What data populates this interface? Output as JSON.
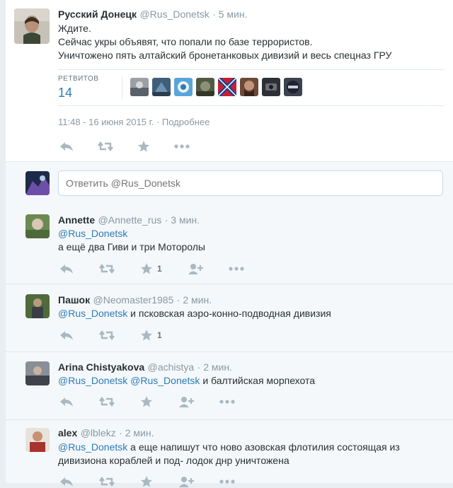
{
  "main_tweet": {
    "name": "Русский Донецк",
    "handle": "@Rus_Donetsk",
    "time": "· 5 мин.",
    "lines": [
      "Ждите.",
      "Сейчас укры объявят, что попали по базе террористов.",
      "Уничтожено пять алтайский бронетанковых дивизий и весь спецназ ГРУ"
    ],
    "retweets_label": "РЕТВИТОВ",
    "retweets_count": "14",
    "date": "11:48 - 16 июня 2015 г. · Подробнее",
    "retweeter_icons": [
      "retweeter-avatar-1",
      "retweeter-avatar-2",
      "retweeter-avatar-3",
      "retweeter-avatar-4",
      "retweeter-avatar-5",
      "retweeter-avatar-6",
      "retweeter-avatar-7",
      "retweeter-avatar-8"
    ]
  },
  "reply_box": {
    "placeholder": "Ответить @Rus_Donetsk"
  },
  "replies": [
    {
      "name": "Annette",
      "handle": "@Annette_rus",
      "time": "· 3 мин.",
      "mention": "@Rus_Donetsk",
      "text_line2": "а ещё два Гиви и три Моторолы",
      "like_count": "1"
    },
    {
      "name": "Пашок",
      "handle": "@Neomaster1985",
      "time": "· 2 мин.",
      "mention": "@Rus_Donetsk",
      "text": "и псковская аэро-конно-подводная дивизия",
      "like_count": "1"
    },
    {
      "name": "Arina Chistyakova",
      "handle": "@achistya",
      "time": "· 2 мин.",
      "mention": "@Rus_Donetsk",
      "mention2": "@Rus_Donetsk",
      "text": "и балтийская морпехота",
      "like_count": ""
    },
    {
      "name": "alex",
      "handle": "@lblekz",
      "time": "· 2 мин.",
      "mention": "@Rus_Donetsk",
      "text": "а еще напишут что ново азовская флотилия состоящая из",
      "text_line2": "дивизиона кораблей и под- лодок днр уничтожена",
      "like_count": ""
    }
  ],
  "colors": {
    "link": "#2b7bb9",
    "icon": "#aab8c2",
    "reply_bg": "#f5f8fa"
  }
}
